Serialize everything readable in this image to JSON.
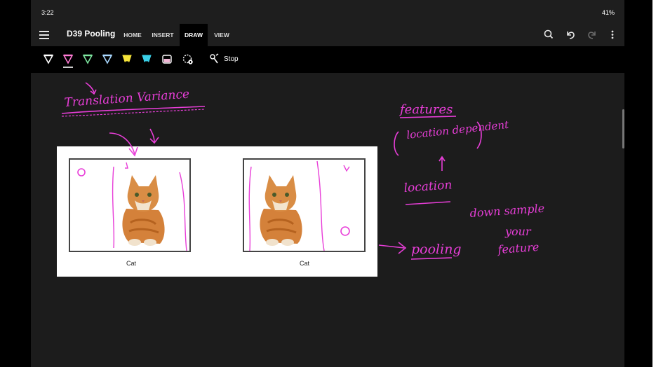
{
  "status": {
    "time": "3:22",
    "right": "41%"
  },
  "app": {
    "doc_title": "D39 Pooling",
    "tabs": [
      {
        "label": "HOME",
        "active": false
      },
      {
        "label": "INSERT",
        "active": false
      },
      {
        "label": "DRAW",
        "active": true
      },
      {
        "label": "VIEW",
        "active": false
      }
    ],
    "icons": [
      "hamburger-icon",
      "search-icon",
      "undo-icon",
      "redo-icon",
      "more-icon"
    ]
  },
  "toolbar": {
    "pens": [
      {
        "name": "pen-white",
        "color": "#ffffff"
      },
      {
        "name": "pen-pink",
        "color": "#ff7bd4"
      },
      {
        "name": "pen-green",
        "color": "#7ee6a0"
      },
      {
        "name": "pen-lightblue",
        "color": "#a9d8ff"
      },
      {
        "name": "highlighter-yellow",
        "color": "#f6e43a"
      },
      {
        "name": "highlighter-cyan",
        "color": "#3ad0e8"
      },
      {
        "name": "highlighter-pink",
        "color": "#f2b6d6"
      }
    ],
    "stop_label": "Stop"
  },
  "slide": {
    "captions": [
      "Cat",
      "Cat"
    ]
  },
  "ink_color": "#e83ed8",
  "handwriting": [
    "Translation Variance",
    "features",
    "location dependent",
    "location",
    "pooling",
    "down sample",
    "your",
    "feature"
  ]
}
